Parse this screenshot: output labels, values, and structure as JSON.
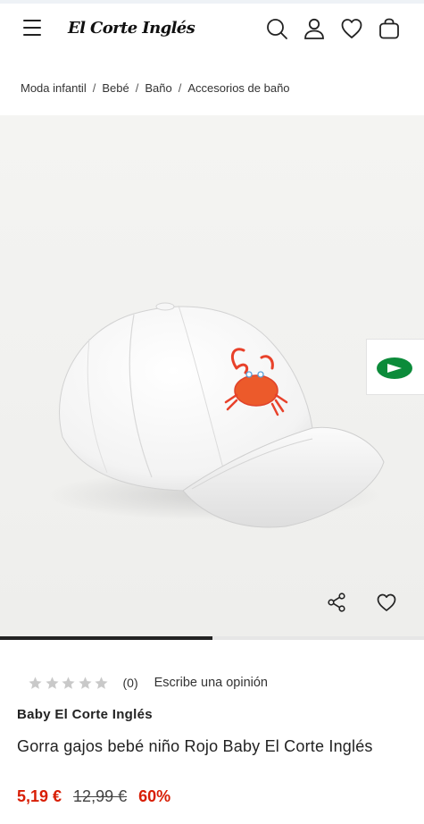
{
  "header": {
    "logo_text": "El Corte Inglés",
    "icons": [
      "menu-icon",
      "search-icon",
      "user-icon",
      "heart-icon",
      "shopping-bag-icon"
    ]
  },
  "breadcrumb": {
    "items": [
      "Moda infantil",
      "Bebé",
      "Baño",
      "Accesorios de baño"
    ],
    "separator": "/"
  },
  "gallery": {
    "image_alt": "Gorra gajos bebé niño Rojo Baby El Corte Inglés",
    "icons": [
      "share-icon",
      "heart-icon"
    ],
    "progress_fraction": 0.5
  },
  "rating": {
    "stars_filled": 0,
    "stars_total": 5,
    "count_text": "(0)",
    "write_review_label": "Escribe una opinión"
  },
  "product": {
    "brand": "Baby El Corte Inglés",
    "title": "Gorra gajos bebé niño Rojo Baby El Corte Inglés",
    "price_current": "5,19 €",
    "price_original": "12,99 €",
    "discount": "60%"
  },
  "colors": {
    "sale_red": "#d81e05",
    "brand_green": "#0c8b3a",
    "text_dark": "#222222"
  }
}
